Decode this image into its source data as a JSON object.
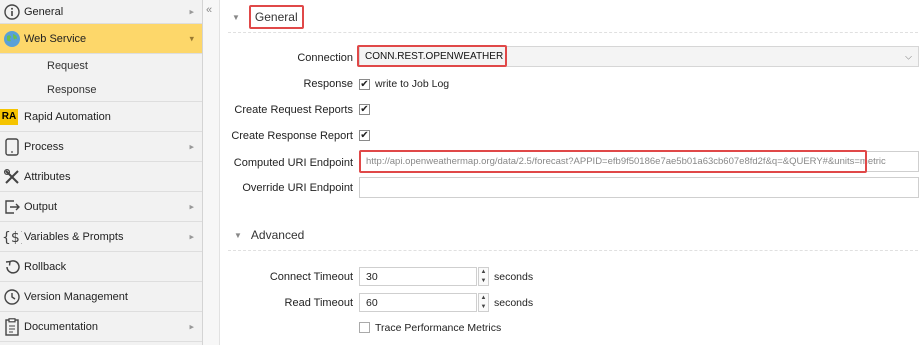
{
  "sidebar": {
    "items": [
      {
        "label": "General",
        "icon": "info-icon"
      },
      {
        "label": "Web Service",
        "icon": "globe-icon",
        "active": true
      },
      {
        "label": "Rapid Automation",
        "icon": "ra-badge-icon",
        "badge": "RA"
      },
      {
        "label": "Process",
        "icon": "tablet-icon"
      },
      {
        "label": "Attributes",
        "icon": "tools-icon"
      },
      {
        "label": "Output",
        "icon": "output-icon"
      },
      {
        "label": "Variables & Prompts",
        "icon": "dollar-icon"
      },
      {
        "label": "Rollback",
        "icon": "rollback-icon"
      },
      {
        "label": "Version Management",
        "icon": "history-icon"
      },
      {
        "label": "Documentation",
        "icon": "document-icon"
      }
    ],
    "sub_items": [
      {
        "label": "Request"
      },
      {
        "label": "Response"
      }
    ],
    "active_color": "#fdd76a"
  },
  "collapse": {
    "glyph": "«"
  },
  "general": {
    "title": "General",
    "connection_label": "Connection",
    "connection_value": "CONN.REST.OPENWEATHER",
    "response_label": "Response",
    "response_checkbox_text": "write to Job Log",
    "create_request_reports_label": "Create Request Reports",
    "create_response_report_label": "Create Response Report",
    "computed_uri_label": "Computed URI Endpoint",
    "computed_uri_value": "http://api.openweathermap.org/data/2.5/forecast?APPID=efb9f50186e7ae5b01a63cb607e8fd2f&q=&QUERY#&units=metric",
    "override_uri_label": "Override URI Endpoint",
    "override_uri_value": ""
  },
  "advanced": {
    "title": "Advanced",
    "connect_timeout_label": "Connect Timeout",
    "connect_timeout_value": "30",
    "connect_timeout_unit": "seconds",
    "read_timeout_label": "Read Timeout",
    "read_timeout_value": "60",
    "read_timeout_unit": "seconds",
    "trace_label": "Trace Performance Metrics"
  },
  "colors": {
    "highlight_border": "#e04848",
    "accent": "#fdd76a"
  }
}
